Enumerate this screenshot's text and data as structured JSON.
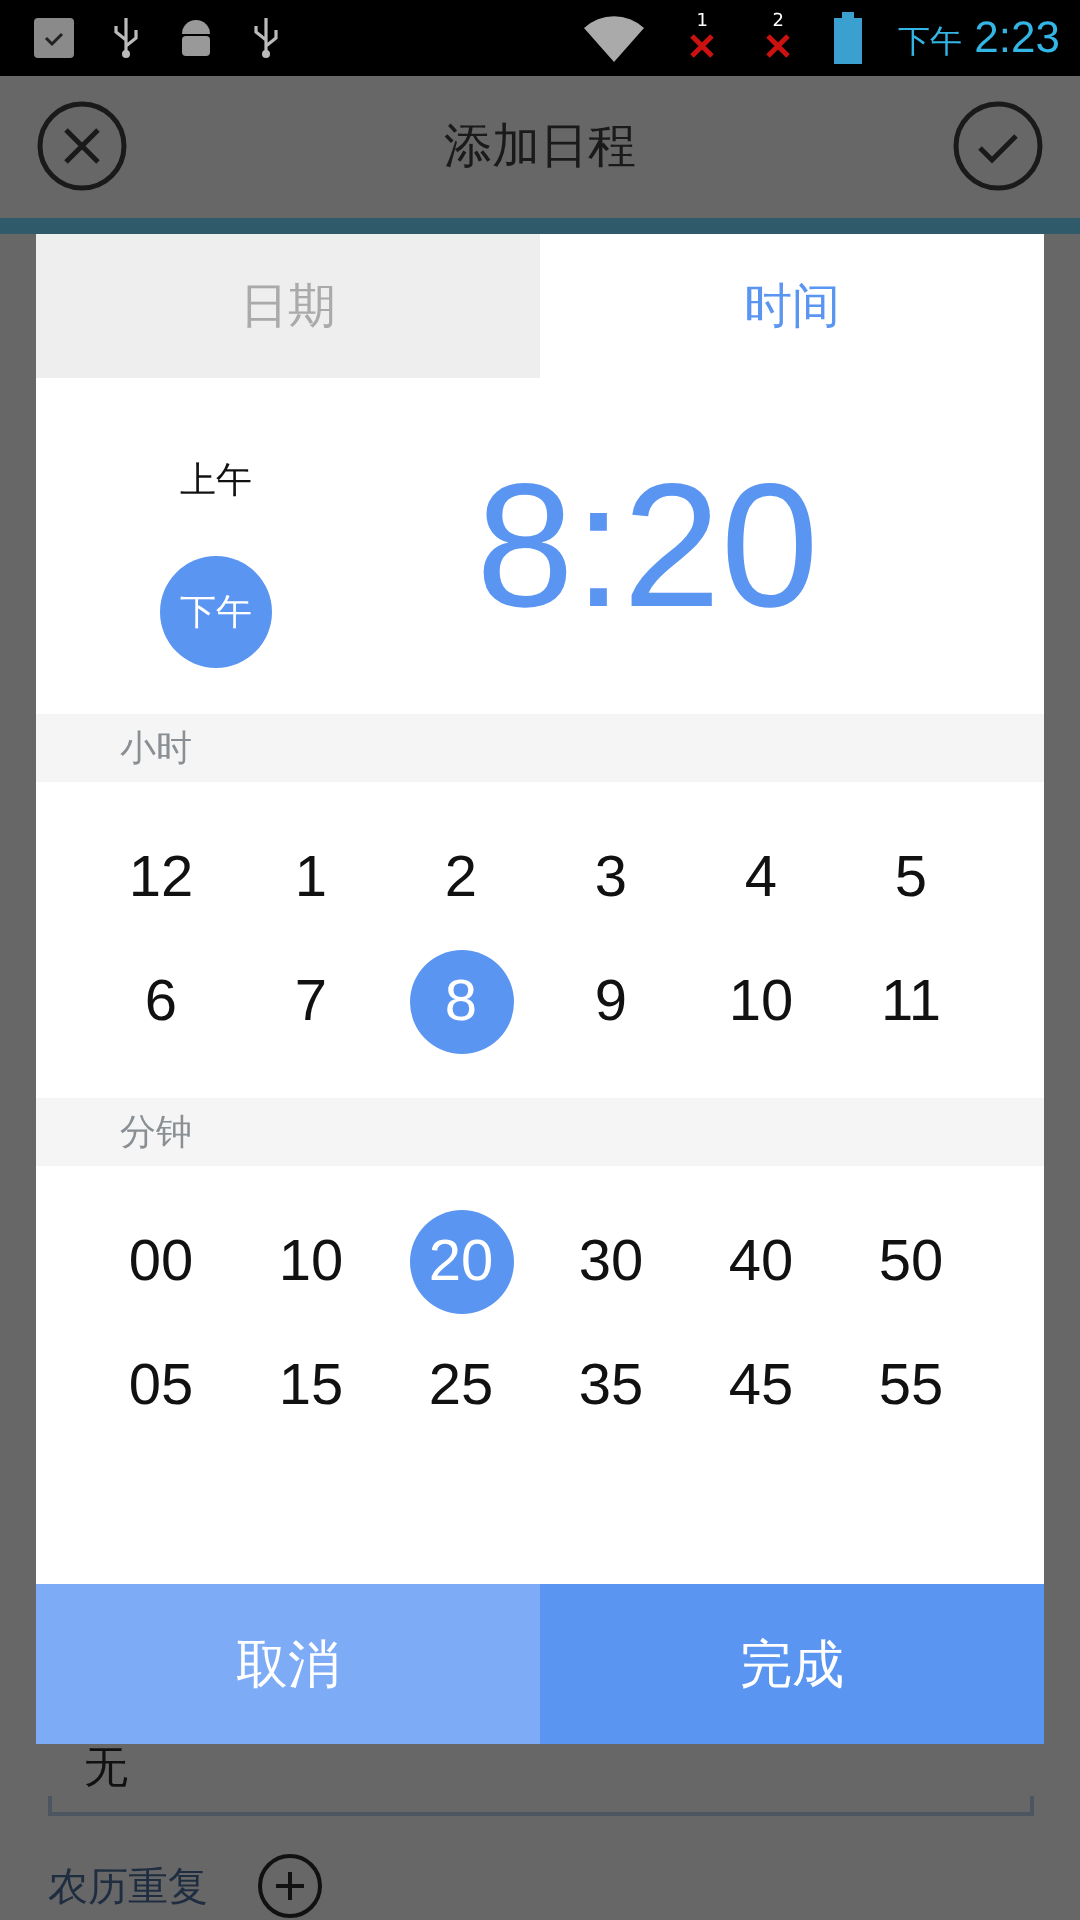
{
  "status_bar": {
    "sim_badges": [
      "1",
      "2"
    ],
    "time_prefix": "下午",
    "time": "2:23"
  },
  "header": {
    "title": "添加日程"
  },
  "dialog": {
    "tabs": [
      {
        "label": "日期",
        "selected": false
      },
      {
        "label": "时间",
        "selected": true
      }
    ],
    "meridiem": [
      {
        "label": "上午",
        "selected": false
      },
      {
        "label": "下午",
        "selected": true
      }
    ],
    "time_display": "8:20",
    "hours": {
      "label": "小时",
      "values": [
        {
          "label": "12",
          "selected": false
        },
        {
          "label": "1",
          "selected": false
        },
        {
          "label": "2",
          "selected": false
        },
        {
          "label": "3",
          "selected": false
        },
        {
          "label": "4",
          "selected": false
        },
        {
          "label": "5",
          "selected": false
        },
        {
          "label": "6",
          "selected": false
        },
        {
          "label": "7",
          "selected": false
        },
        {
          "label": "8",
          "selected": true
        },
        {
          "label": "9",
          "selected": false
        },
        {
          "label": "10",
          "selected": false
        },
        {
          "label": "11",
          "selected": false
        }
      ]
    },
    "minutes": {
      "label": "分钟",
      "values": [
        {
          "label": "00",
          "selected": false
        },
        {
          "label": "10",
          "selected": false
        },
        {
          "label": "20",
          "selected": true
        },
        {
          "label": "30",
          "selected": false
        },
        {
          "label": "40",
          "selected": false
        },
        {
          "label": "50",
          "selected": false
        },
        {
          "label": "05",
          "selected": false
        },
        {
          "label": "15",
          "selected": false
        },
        {
          "label": "25",
          "selected": false
        },
        {
          "label": "35",
          "selected": false
        },
        {
          "label": "45",
          "selected": false
        },
        {
          "label": "55",
          "selected": false
        }
      ]
    },
    "buttons": [
      {
        "label": "取消",
        "kind": "cancel"
      },
      {
        "label": "完成",
        "kind": "confirm"
      }
    ]
  },
  "form": {
    "repeat_value": "无",
    "lunar_repeat_label": "农历重复"
  }
}
